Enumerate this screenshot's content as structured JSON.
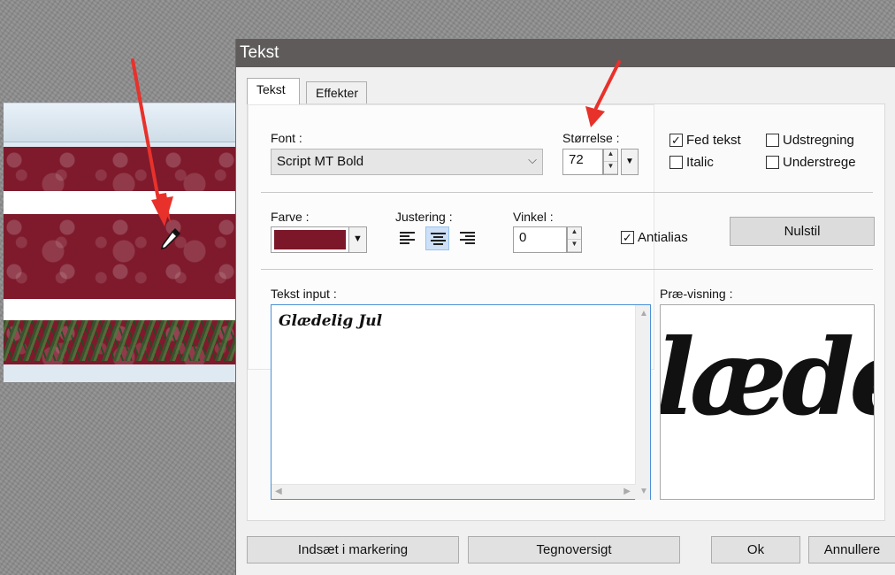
{
  "dialog": {
    "title": "Tekst",
    "close_glyph": "✕",
    "tabs": [
      {
        "label": "Tekst",
        "active": true
      },
      {
        "label": "Effekter",
        "active": false
      }
    ]
  },
  "font": {
    "label": "Font :",
    "value": "Script MT Bold"
  },
  "size": {
    "label": "Størrelse :",
    "value": "72"
  },
  "style_options": [
    {
      "label": "Fed tekst",
      "checked": true
    },
    {
      "label": "Italic",
      "checked": false
    },
    {
      "label": "Udstregning",
      "checked": false
    },
    {
      "label": "Understrege",
      "checked": false
    }
  ],
  "color": {
    "label": "Farve :",
    "swatch": "#7b1728"
  },
  "alignment": {
    "label": "Justering :",
    "options": [
      "left",
      "center",
      "right"
    ],
    "selected": "center"
  },
  "angle": {
    "label": "Vinkel :",
    "value": "0"
  },
  "antialias": {
    "label": "Antialias",
    "checked": true
  },
  "reset_button": "Nulstil",
  "text_input": {
    "label": "Tekst input :",
    "value": "Glædelig Jul"
  },
  "preview": {
    "label": "Præ-visning :",
    "sample": "lædel"
  },
  "buttons": {
    "insert": "Indsæt i markering",
    "charmap": "Tegnoversigt",
    "ok": "Ok",
    "cancel": "Annullere"
  },
  "glyphs": {
    "check": "✓",
    "dropdown": "▾",
    "spin_up": "▲",
    "spin_down": "▼",
    "scroll_up": "▲",
    "scroll_down": "▼",
    "scroll_left": "◀",
    "scroll_right": "▶"
  },
  "colors": {
    "annotation_arrow": "#e8312b",
    "titlebar": "#5e5b5a",
    "focus_border": "#4a90d9"
  }
}
